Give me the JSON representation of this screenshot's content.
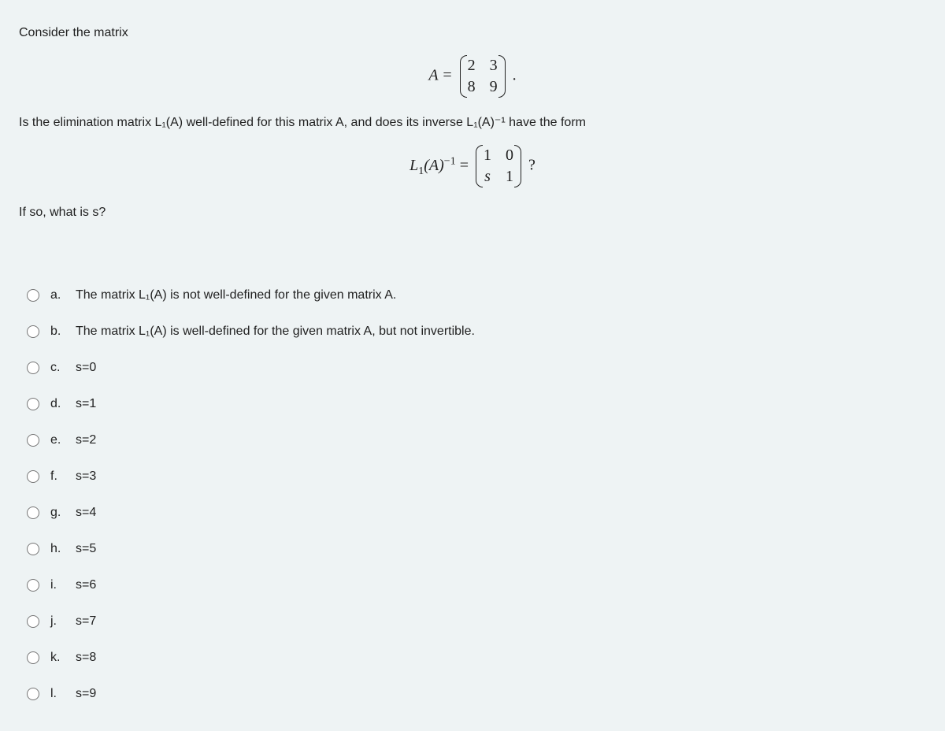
{
  "question": {
    "intro": "Consider the matrix",
    "matrixA": {
      "lhs": "A =",
      "cells": [
        "2",
        "3",
        "8",
        "9"
      ],
      "trail": "."
    },
    "mid": "Is the elimination matrix L₁(A) well-defined for this matrix A, and does its inverse L₁(A)⁻¹ have the form",
    "matrixL": {
      "lhs": "L₁(A)⁻¹ =",
      "lhs_plain_prefix": "L",
      "lhs_sub": "1",
      "lhs_arg": "(A)",
      "lhs_sup": "−1",
      "lhs_eq": " = ",
      "cells": [
        "1",
        "0",
        "s",
        "1"
      ],
      "trail": "?"
    },
    "tail": "If so, what is s?"
  },
  "options": [
    {
      "letter": "a.",
      "text": "The matrix L₁(A) is not well-defined for the given matrix A."
    },
    {
      "letter": "b.",
      "text": "The matrix L₁(A) is well-defined for the given matrix A, but not invertible."
    },
    {
      "letter": "c.",
      "text": "s=0"
    },
    {
      "letter": "d.",
      "text": "s=1"
    },
    {
      "letter": "e.",
      "text": "s=2"
    },
    {
      "letter": "f.",
      "text": "s=3"
    },
    {
      "letter": "g.",
      "text": "s=4"
    },
    {
      "letter": "h.",
      "text": "s=5"
    },
    {
      "letter": "i.",
      "text": "s=6"
    },
    {
      "letter": "j.",
      "text": "s=7"
    },
    {
      "letter": "k.",
      "text": "s=8"
    },
    {
      "letter": "l.",
      "text": "s=9"
    }
  ]
}
